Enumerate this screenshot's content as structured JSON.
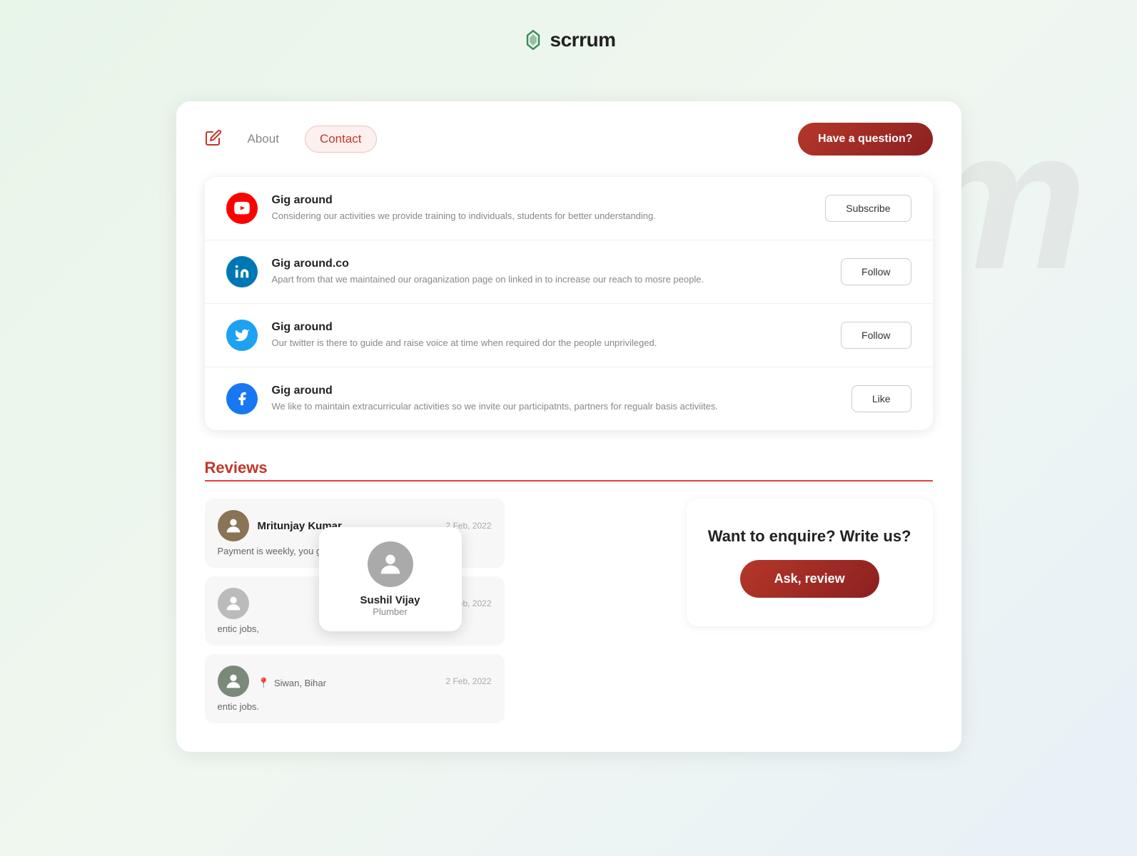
{
  "app": {
    "name": "scrrum",
    "logo_icon": "diamond"
  },
  "watermark": {
    "text": "Scrrum"
  },
  "header": {
    "have_question_label": "Have a question?"
  },
  "tabs": {
    "about_label": "About",
    "contact_label": "Contact"
  },
  "social_items": [
    {
      "platform": "YouTube",
      "icon_type": "youtube",
      "name": "Gig around",
      "description": "Considering our activities we provide training to individuals, students for better understanding.",
      "action_label": "Subscribe"
    },
    {
      "platform": "LinkedIn",
      "icon_type": "linkedin",
      "name": "Gig around.co",
      "description": "Apart from that we maintained our oraganization page on linked in to increase our reach to mosre people.",
      "action_label": "Follow"
    },
    {
      "platform": "Twitter",
      "icon_type": "twitter",
      "name": "Gig around",
      "description": "Our twitter is there to guide and raise voice at time when required dor the people unprivileged.",
      "action_label": "Follow"
    },
    {
      "platform": "Facebook",
      "icon_type": "facebook",
      "name": "Gig around",
      "description": "We like to maintain extracurricular activities so we invite our participatnts, partners for regualr basis activiites.",
      "action_label": "Like"
    }
  ],
  "reviews": {
    "title": "Reviews",
    "items": [
      {
        "name": "Mritunjay Kumar",
        "date": "2 Feb, 2022",
        "text": "Payment is weekly, you get authentic jobs,",
        "avatar_color": "#8b7355"
      },
      {
        "name": "Sushil Vijay",
        "role": "Plumber",
        "date": "2 Feb, 2022",
        "text": "entic jobs,",
        "avatar_color": "#666"
      },
      {
        "name": "",
        "location": "Siwan, Bihar",
        "date": "2 Feb, 2022",
        "text": "entic jobs.",
        "avatar_color": "#7a8a7a"
      }
    ]
  },
  "enquire": {
    "title": "Want to enquire? Write us?",
    "button_label": "Ask, review"
  },
  "popup": {
    "name": "Sushil Vijay",
    "role": "Plumber"
  }
}
